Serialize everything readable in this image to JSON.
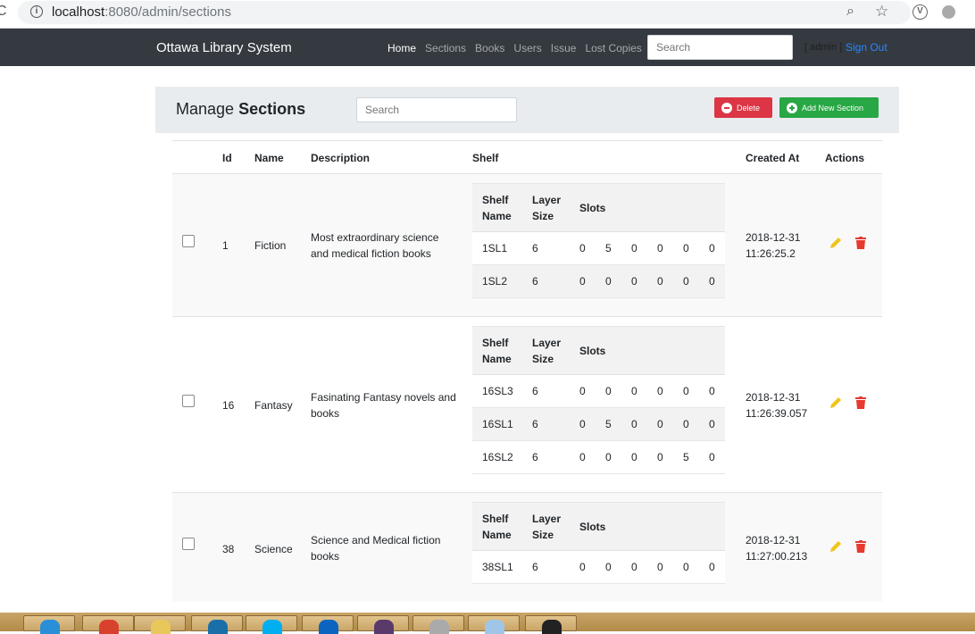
{
  "browser": {
    "url_host": "localhost",
    "url_rest": ":8080/admin/sections"
  },
  "navbar": {
    "brand": "Ottawa Library System",
    "links": [
      {
        "label": "Home",
        "active": true
      },
      {
        "label": "Sections",
        "active": false
      },
      {
        "label": "Books",
        "active": false
      },
      {
        "label": "Users",
        "active": false
      },
      {
        "label": "Issue",
        "active": false
      },
      {
        "label": "Lost Copies",
        "active": false
      }
    ],
    "search_placeholder": "Search",
    "user": "[ admin ]",
    "signout": "Sign Out"
  },
  "panel": {
    "title_prefix": "Manage",
    "title_bold": "Sections",
    "search_placeholder": "Search",
    "delete_label": "Delete",
    "add_label": "Add New Section"
  },
  "table": {
    "headers": {
      "id": "Id",
      "name": "Name",
      "description": "Description",
      "shelf": "Shelf",
      "created": "Created At",
      "actions": "Actions"
    },
    "shelf_headers": {
      "name": "Shelf Name",
      "layer": "Layer Size",
      "slots": "Slots"
    },
    "rows": [
      {
        "id": "1",
        "name": "Fiction",
        "description": "Most extraordinary science and medical fiction books",
        "created_date": "2018-12-31",
        "created_time": "11:26:25.2",
        "shelves": [
          {
            "name": "1SL1",
            "layer": "6",
            "slots": [
              "0",
              "5",
              "0",
              "0",
              "0",
              "0"
            ]
          },
          {
            "name": "1SL2",
            "layer": "6",
            "slots": [
              "0",
              "0",
              "0",
              "0",
              "0",
              "0"
            ]
          }
        ]
      },
      {
        "id": "16",
        "name": "Fantasy",
        "description": "Fasinating Fantasy novels and books",
        "created_date": "2018-12-31",
        "created_time": "11:26:39.057",
        "shelves": [
          {
            "name": "16SL3",
            "layer": "6",
            "slots": [
              "0",
              "0",
              "0",
              "0",
              "0",
              "0"
            ]
          },
          {
            "name": "16SL1",
            "layer": "6",
            "slots": [
              "0",
              "5",
              "0",
              "0",
              "0",
              "0"
            ]
          },
          {
            "name": "16SL2",
            "layer": "6",
            "slots": [
              "0",
              "0",
              "0",
              "0",
              "5",
              "0"
            ]
          }
        ]
      },
      {
        "id": "38",
        "name": "Science",
        "description": "Science and Medical fiction books",
        "created_date": "2018-12-31",
        "created_time": "11:27:00.213",
        "shelves": [
          {
            "name": "38SL1",
            "layer": "6",
            "slots": [
              "0",
              "0",
              "0",
              "0",
              "0",
              "0"
            ]
          }
        ]
      }
    ]
  },
  "colors": {
    "navbar": "#343a40",
    "delete": "#dc3545",
    "add": "#28a745",
    "edit": "#f0c419",
    "trash": "#e8392f",
    "link": "#2b84ff"
  }
}
